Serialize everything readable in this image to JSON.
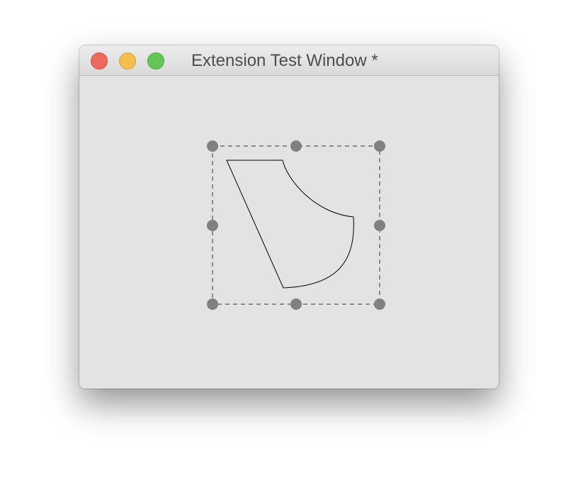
{
  "window": {
    "title": "Extension Test Window *",
    "background": "#e3e3e3"
  },
  "traffic_lights": [
    {
      "name": "close",
      "color": "#ee6a5f"
    },
    {
      "name": "minimize",
      "color": "#f5be4f"
    },
    {
      "name": "zoom",
      "color": "#62c554"
    }
  ],
  "selection": {
    "handle_color": "#808080",
    "border_color": "#6f6f6f",
    "border_style": "dashed",
    "handles": [
      "top-left",
      "top-center",
      "top-right",
      "middle-left",
      "middle-right",
      "bottom-left",
      "bottom-center",
      "bottom-right"
    ]
  },
  "shape": {
    "type": "curved-quadrilateral",
    "stroke": "#000000",
    "fill": "none"
  }
}
